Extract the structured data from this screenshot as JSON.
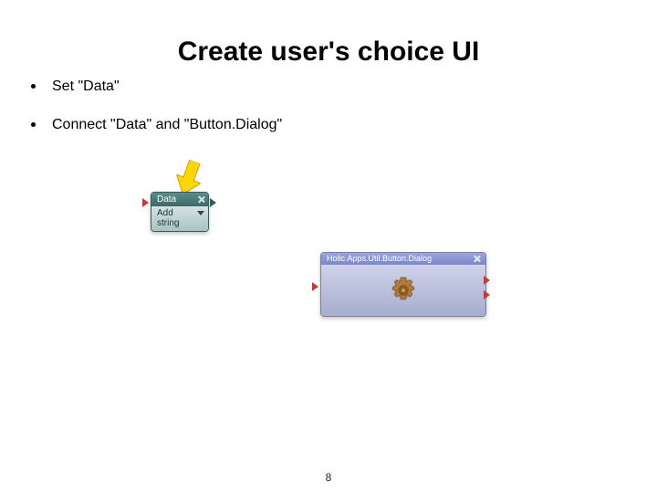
{
  "title": "Create user's choice UI",
  "bullets": [
    "Set \"Data\"",
    "Connect \"Data\" and \"Button.Dialog\""
  ],
  "nodes": {
    "data": {
      "title": "Data",
      "add_label": "Add",
      "type_label": "string"
    },
    "dialog": {
      "title": "Holic.Apps.Util.Button.Dialog"
    }
  },
  "icons": {
    "close": "close-icon",
    "dropdown": "chevron-down-icon",
    "gear": "gear-icon",
    "arrow": "attention-arrow-icon",
    "port_in": "port-in-icon",
    "port_out": "port-out-icon"
  },
  "page_number": "8"
}
